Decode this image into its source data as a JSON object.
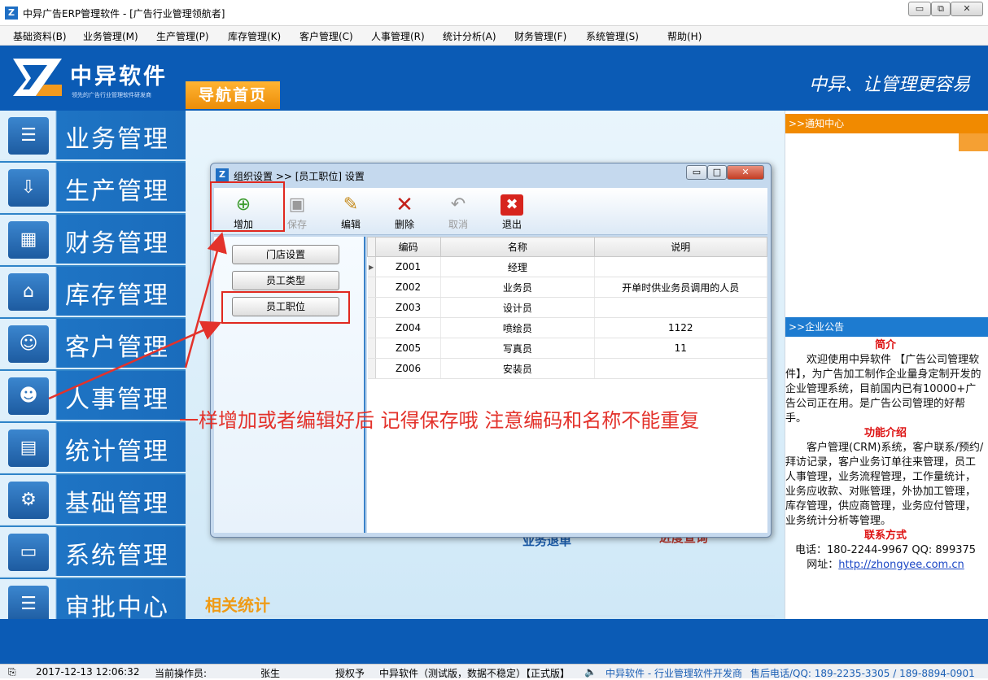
{
  "window": {
    "title": "中异广告ERP管理软件 - [广告行业管理领航者]",
    "minimize": "▭",
    "restore": "⧉",
    "close": "✕"
  },
  "menu": [
    "基础资料(B)",
    "业务管理(M)",
    "生产管理(P)",
    "库存管理(K)",
    "客户管理(C)",
    "人事管理(R)",
    "统计分析(A)",
    "财务管理(F)",
    "系统管理(S)",
    "帮助(H)"
  ],
  "banner": {
    "brand": "中异软件",
    "brand_sub": "领先的广告行业管理软件研发商",
    "nav_tab": "导航首页",
    "slogan": "中异、让管理更容易"
  },
  "left_nav": [
    {
      "label": "业务管理",
      "icon": "document-list-icon"
    },
    {
      "label": "生产管理",
      "icon": "production-icon"
    },
    {
      "label": "财务管理",
      "icon": "calculator-icon"
    },
    {
      "label": "库存管理",
      "icon": "warehouse-icon"
    },
    {
      "label": "客户管理",
      "icon": "customer-icon"
    },
    {
      "label": "人事管理",
      "icon": "people-icon"
    },
    {
      "label": "统计管理",
      "icon": "statistics-icon"
    },
    {
      "label": "基础管理",
      "icon": "gears-icon"
    },
    {
      "label": "系统管理",
      "icon": "monitor-icon"
    },
    {
      "label": "审批中心",
      "icon": "approval-icon"
    }
  ],
  "center": {
    "ghost_left": "业务退单",
    "ghost_right": "进度查询",
    "related_stats": "相关统计"
  },
  "right_panel": {
    "notice_header": ">>通知中心",
    "announce_header": ">>企业公告",
    "intro_title": "简介",
    "intro_text": "欢迎使用中异软件 【广告公司管理软件】，为广告加工制作企业量身定制开发的企业管理系统，目前国内已有10000+广告公司正在用。是广告公司管理的好帮手。",
    "features_title": "功能介绍",
    "features_text": "客户管理(CRM)系统，客户联系/预约/拜访记录，客户业务订单往来管理，员工人事管理，业务流程管理，工作量统计，业务应收款、对账管理，外协加工管理，库存管理，供应商管理，业务应付管理，业务统计分析等管理。",
    "contact_title": "联系方式",
    "phone_line": "电话：180-2244-9967  QQ: 899375",
    "web_label": "网址：",
    "web_url": "http://zhongyee.com.cn"
  },
  "dialog": {
    "title": "组织设置 >> [员工职位] 设置",
    "toolbar": [
      {
        "label": "增加",
        "icon": "add-document-icon",
        "enabled": true
      },
      {
        "label": "保存",
        "icon": "save-disk-icon",
        "enabled": false
      },
      {
        "label": "编辑",
        "icon": "edit-icon",
        "enabled": true
      },
      {
        "label": "删除",
        "icon": "delete-x-icon",
        "enabled": true
      },
      {
        "label": "取消",
        "icon": "undo-icon",
        "enabled": false
      },
      {
        "label": "退出",
        "icon": "exit-icon",
        "enabled": true
      }
    ],
    "side_buttons": [
      "门店设置",
      "员工类型",
      "员工职位"
    ],
    "columns": [
      "编码",
      "名称",
      "说明"
    ],
    "rows": [
      {
        "code": "Z001",
        "name": "经理",
        "desc": ""
      },
      {
        "code": "Z002",
        "name": "业务员",
        "desc": "开单时供业务员调用的人员"
      },
      {
        "code": "Z003",
        "name": "设计员",
        "desc": ""
      },
      {
        "code": "Z004",
        "name": "喷绘员",
        "desc": "1122"
      },
      {
        "code": "Z005",
        "name": "写真员",
        "desc": "11"
      },
      {
        "code": "Z006",
        "name": "安装员",
        "desc": ""
      }
    ]
  },
  "annotation": "一样增加或者编辑好后 记得保存哦 注意编码和名称不能重复",
  "status": {
    "datetime": "2017-12-13 12:06:32",
    "operator_label": "当前操作员:",
    "operator": "张生",
    "license_label": "授权予",
    "version": "中异软件（测试版，数据不稳定）【正式版】",
    "company": "中异软件 - 行业管理软件开发商",
    "hotline": "售后电话/QQ: 189-2235-3305 / 189-8894-0901"
  },
  "colors": {
    "banner": "#0b5bb5",
    "accent": "#f18a00",
    "annotation": "#e3322b"
  }
}
